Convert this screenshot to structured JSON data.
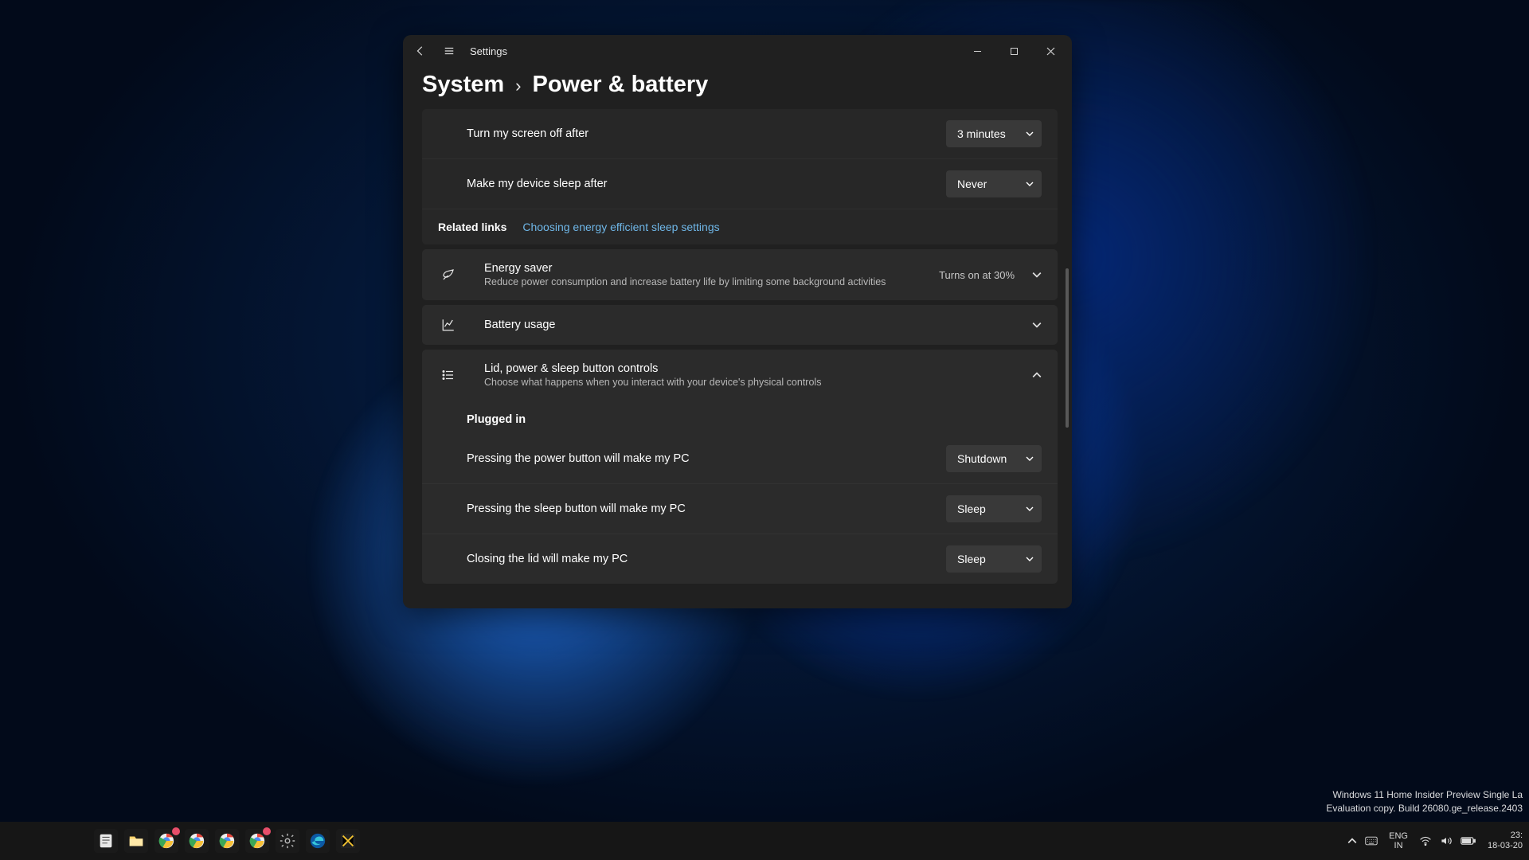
{
  "titlebar": {
    "title": "Settings"
  },
  "breadcrumb": {
    "parent": "System",
    "current": "Power & battery"
  },
  "screen_sleep": {
    "screen_off_label": "Turn my screen off after",
    "screen_off_value": "3 minutes",
    "sleep_after_label": "Make my device sleep after",
    "sleep_after_value": "Never"
  },
  "related": {
    "label": "Related links",
    "link": "Choosing energy efficient sleep settings"
  },
  "energy_saver": {
    "title": "Energy saver",
    "sub": "Reduce power consumption and increase battery life by limiting some background activities",
    "value": "Turns on at 30%"
  },
  "battery_usage": {
    "title": "Battery usage"
  },
  "lid_controls": {
    "title": "Lid, power & sleep button controls",
    "sub": "Choose what happens when you interact with your device's physical controls",
    "section": "Plugged in",
    "rows": [
      {
        "label": "Pressing the power button will make my PC",
        "value": "Shutdown"
      },
      {
        "label": "Pressing the sleep button will make my PC",
        "value": "Sleep"
      },
      {
        "label": "Closing the lid will make my PC",
        "value": "Sleep"
      }
    ]
  },
  "watermark": {
    "line1": "Windows 11 Home Insider Preview Single La",
    "line2": "Evaluation copy. Build 26080.ge_release.2403"
  },
  "tray": {
    "lang_top": "ENG",
    "lang_bottom": "IN",
    "time": "23:",
    "date": "18-03-20"
  }
}
